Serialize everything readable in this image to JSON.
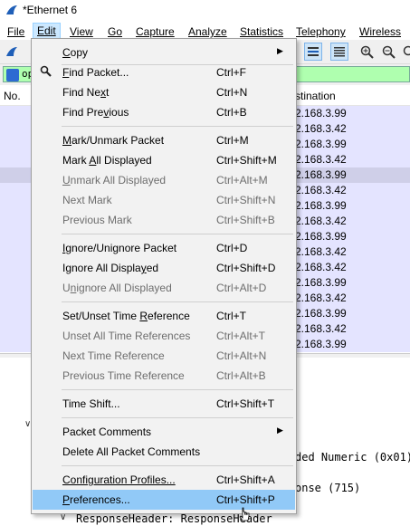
{
  "window": {
    "title": "*Ethernet 6"
  },
  "menubar": [
    {
      "label": "File"
    },
    {
      "label": "Edit"
    },
    {
      "label": "View"
    },
    {
      "label": "Go"
    },
    {
      "label": "Capture"
    },
    {
      "label": "Analyze"
    },
    {
      "label": "Statistics"
    },
    {
      "label": "Telephony"
    },
    {
      "label": "Wireless"
    }
  ],
  "filter": {
    "text": "op"
  },
  "packet_list": {
    "col_no": "No.",
    "col_dst": "stination",
    "rows": [
      "2.168.3.99",
      "2.168.3.42",
      "2.168.3.99",
      "2.168.3.42",
      "2.168.3.99",
      "2.168.3.42",
      "2.168.3.99",
      "2.168.3.42",
      "2.168.3.99",
      "2.168.3.42",
      "2.168.3.42",
      "2.168.3.99",
      "2.168.3.42",
      "2.168.3.99",
      "2.168.3.42",
      "2.168.3.99"
    ],
    "selected_row": 4
  },
  "details": {
    "line1": "ded Numeric (0x01)",
    "line2": "onse (715)",
    "line3": "ResponseHeader: ResponseHeader"
  },
  "edit_menu": {
    "copy": {
      "u": "C",
      "rest": "opy"
    },
    "find_packet": {
      "u": "F",
      "rest": "ind Packet...",
      "shortcut": "Ctrl+F"
    },
    "find_next": {
      "pre": "Find Ne",
      "u": "x",
      "rest": "t",
      "shortcut": "Ctrl+N"
    },
    "find_previous": {
      "pre": "Find Pre",
      "u": "v",
      "rest": "ious",
      "shortcut": "Ctrl+B"
    },
    "mark_unmark": {
      "u": "M",
      "rest": "ark/Unmark Packet",
      "shortcut": "Ctrl+M"
    },
    "mark_all": {
      "pre": "Mark ",
      "u": "A",
      "rest": "ll Displayed",
      "shortcut": "Ctrl+Shift+M"
    },
    "unmark_all": {
      "u": "U",
      "rest": "nmark All Displayed",
      "shortcut": "Ctrl+Alt+M"
    },
    "next_mark": {
      "label": "Next Mark",
      "shortcut": "Ctrl+Shift+N"
    },
    "previous_mark": {
      "label": "Previous Mark",
      "shortcut": "Ctrl+Shift+B"
    },
    "ignore_unignore": {
      "u": "I",
      "rest": "gnore/Unignore Packet",
      "shortcut": "Ctrl+D"
    },
    "ignore_all": {
      "pre": "Ignore All Displa",
      "u": "y",
      "rest": "ed",
      "shortcut": "Ctrl+Shift+D"
    },
    "unignore_all": {
      "pre": "U",
      "u": "n",
      "rest": "ignore All Displayed",
      "shortcut": "Ctrl+Alt+D"
    },
    "set_time_ref": {
      "pre": "Set/Unset Time ",
      "u": "R",
      "rest": "eference",
      "shortcut": "Ctrl+T"
    },
    "unset_all_time_refs": {
      "label": "Unset All Time References",
      "shortcut": "Ctrl+Alt+T"
    },
    "next_time_ref": {
      "label": "Next Time Reference",
      "shortcut": "Ctrl+Alt+N"
    },
    "prev_time_ref": {
      "label": "Previous Time Reference",
      "shortcut": "Ctrl+Alt+B"
    },
    "time_shift": {
      "label": "Time Shift...",
      "shortcut": "Ctrl+Shift+T"
    },
    "packet_comments": {
      "label": "Packet Comments"
    },
    "delete_all_comments": {
      "label": "Delete All Packet Comments"
    },
    "config_profiles": {
      "pre": "Configuration Profiles...",
      "shortcut": "Ctrl+Shift+A"
    },
    "preferences": {
      "u": "P",
      "rest": "references...",
      "shortcut": "Ctrl+Shift+P"
    }
  },
  "colors": {
    "row_bg": "#e4e4ff",
    "row_selected": "#cfcfe8",
    "filter_ok": "#afffaf",
    "menu_highlight": "#91c9f7",
    "menu_bg": "#f2f2f2"
  }
}
